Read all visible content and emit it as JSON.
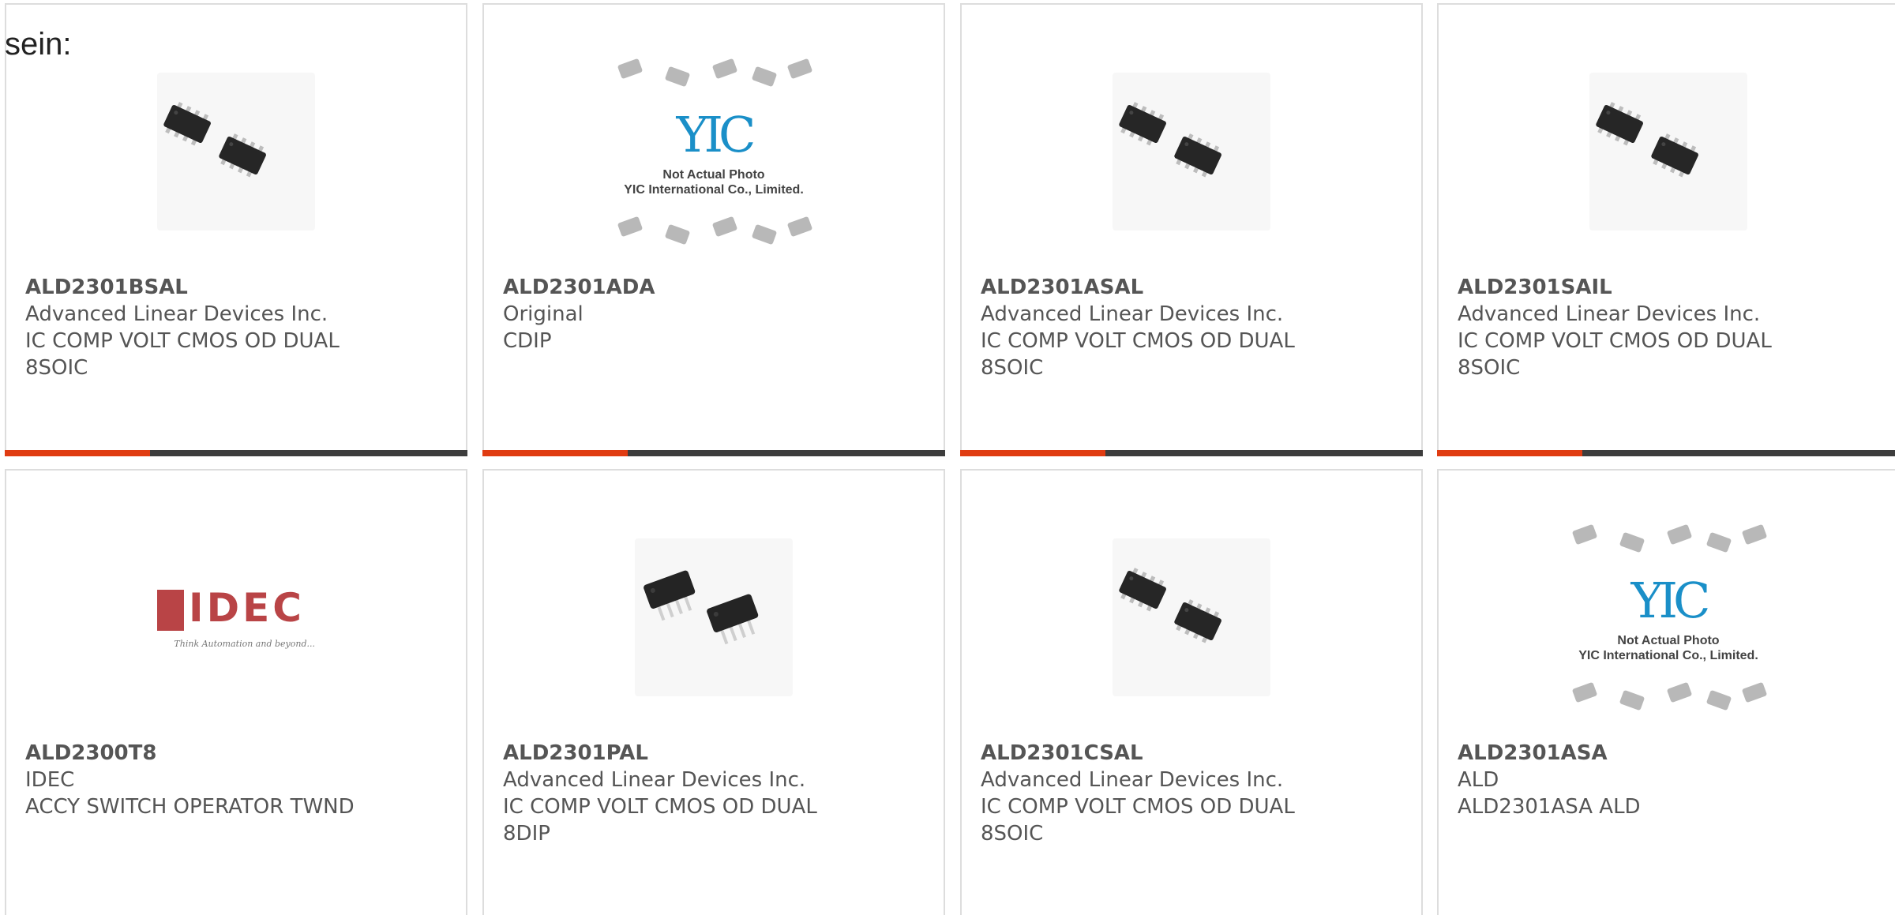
{
  "intro_text": "sein:",
  "products": [
    {
      "part": "ALD2301BSAL",
      "maker": "Advanced Linear Devices Inc.",
      "desc": "IC COMP VOLT CMOS OD DUAL",
      "package": "8SOIC",
      "image": "soic-chip-photo"
    },
    {
      "part": "ALD2301ADA",
      "maker": "Original",
      "desc": "CDIP",
      "package": "",
      "image": "yic-placeholder"
    },
    {
      "part": "ALD2301ASAL",
      "maker": "Advanced Linear Devices Inc.",
      "desc": "IC COMP VOLT CMOS OD DUAL",
      "package": "8SOIC",
      "image": "soic-chip-photo"
    },
    {
      "part": "ALD2301SAIL",
      "maker": "Advanced Linear Devices Inc.",
      "desc": "IC COMP VOLT CMOS OD DUAL",
      "package": "8SOIC",
      "image": "soic-chip-photo"
    },
    {
      "part": "ALD2300T8",
      "maker": "IDEC",
      "desc": "ACCY SWITCH OPERATOR TWND",
      "package": "",
      "image": "idec-logo"
    },
    {
      "part": "ALD2301PAL",
      "maker": "Advanced Linear Devices Inc.",
      "desc": "IC COMP VOLT CMOS OD DUAL",
      "package": "8DIP",
      "image": "dip-chip-photo"
    },
    {
      "part": "ALD2301CSAL",
      "maker": "Advanced Linear Devices Inc.",
      "desc": "IC COMP VOLT CMOS OD DUAL",
      "package": "8SOIC",
      "image": "soic-chip-photo"
    },
    {
      "part": "ALD2301ASA",
      "maker": "ALD",
      "desc": "ALD2301ASA ALD",
      "package": "",
      "image": "yic-placeholder"
    }
  ],
  "placeholder": {
    "logo": "YIC",
    "line1": "Not Actual Photo",
    "line2": "YIC International Co., Limited."
  },
  "idec_logo": {
    "word": "IDEC",
    "tagline": "Think Automation and beyond..."
  },
  "colors": {
    "accent": "#e03c12",
    "bar": "#3d3d3d",
    "yic_blue": "#1a8fc8",
    "idec_red": "#b94446"
  }
}
